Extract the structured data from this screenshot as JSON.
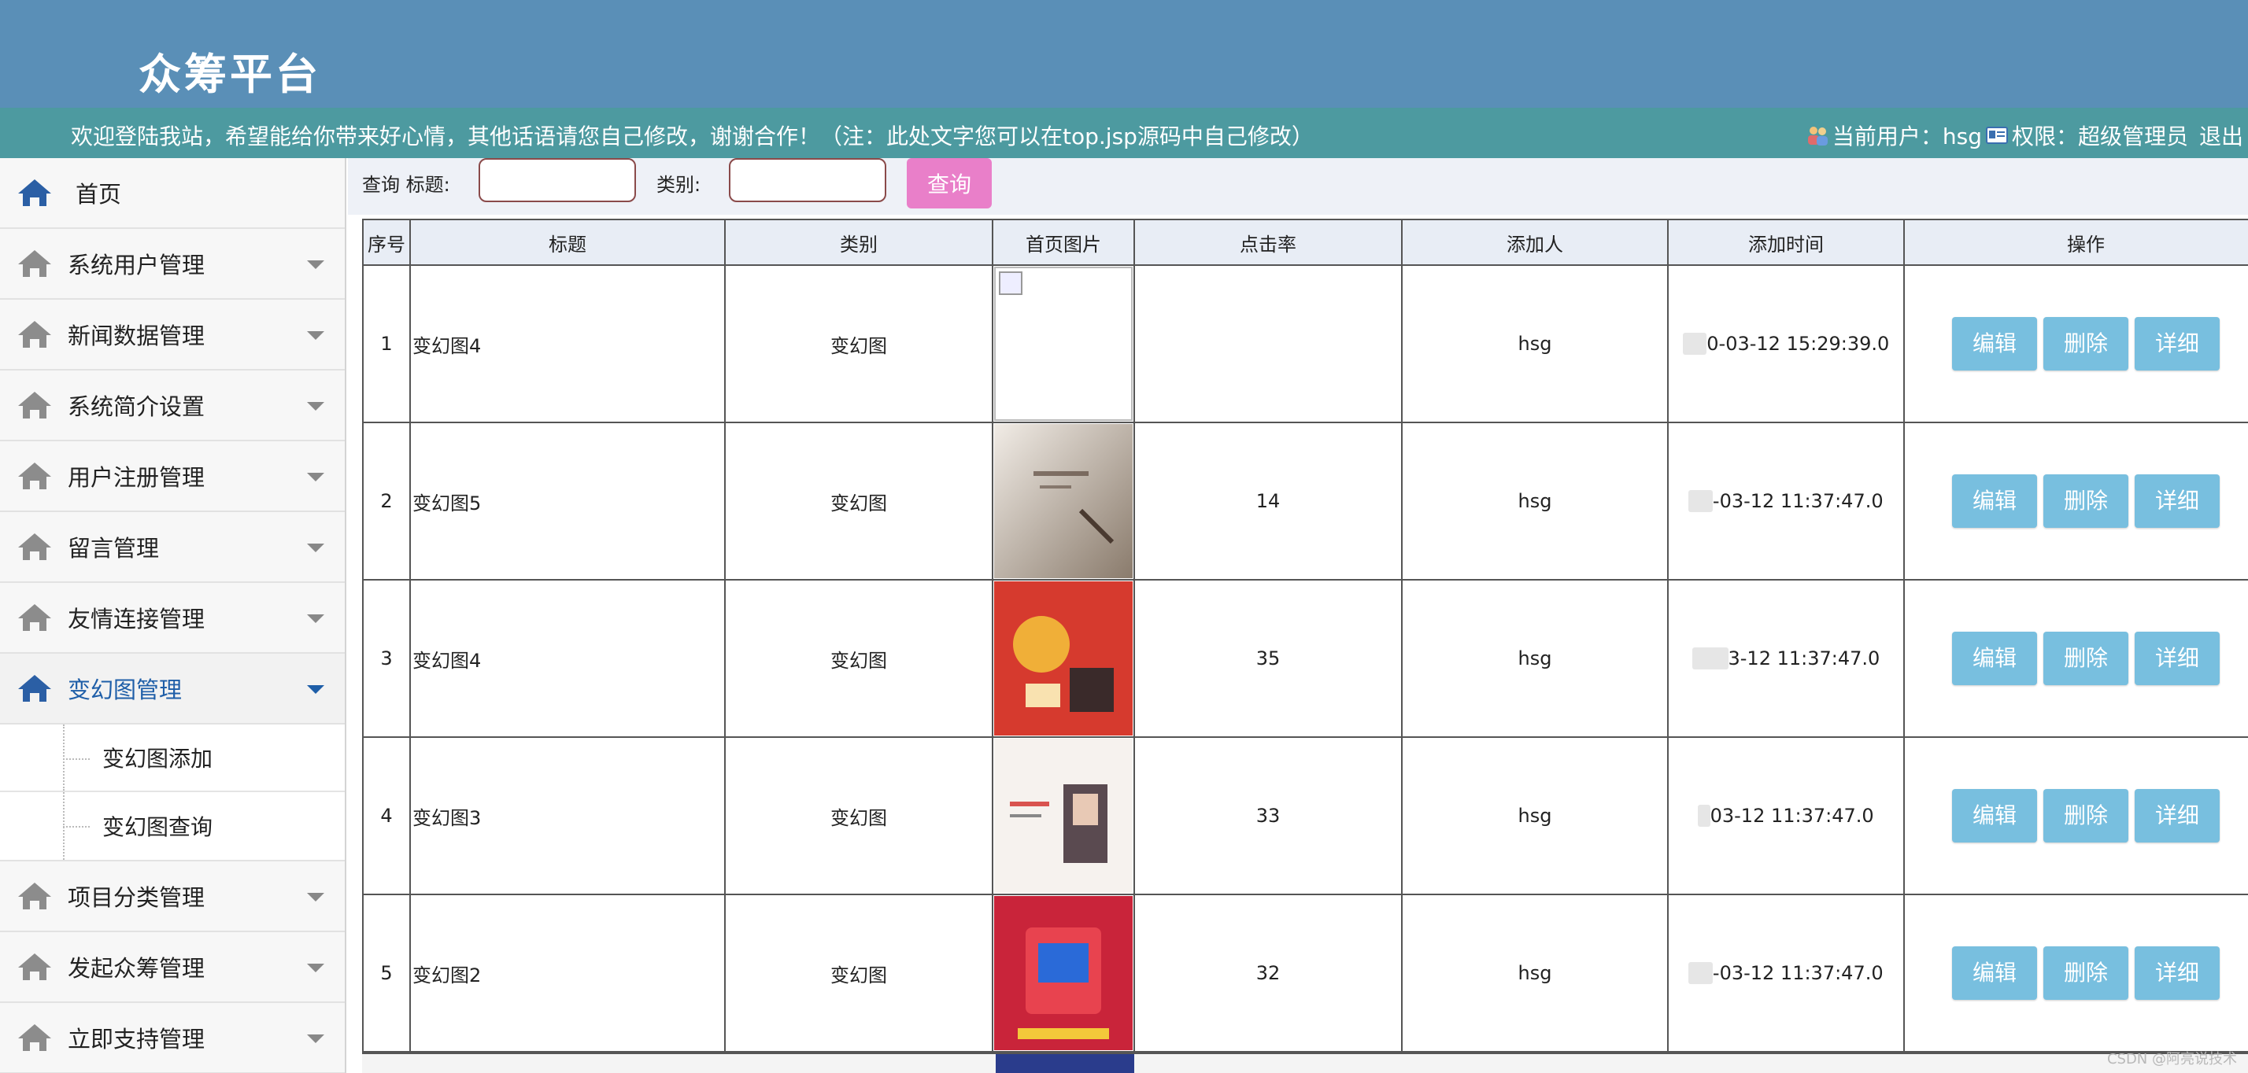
{
  "header": {
    "title": "众筹平台",
    "welcome": "欢迎登陆我站，希望能给你带来好心情，其他话语请您自己修改，谢谢合作！（注：此处文字您可以在top.jsp源码中自己修改）",
    "current_user_label": "当前用户：hsg",
    "role_label": "权限：超级管理员",
    "logout": "退出"
  },
  "sidebar": {
    "home": "首页",
    "items": [
      {
        "label": "系统用户管理"
      },
      {
        "label": "新闻数据管理"
      },
      {
        "label": "系统简介设置"
      },
      {
        "label": "用户注册管理"
      },
      {
        "label": "留言管理"
      },
      {
        "label": "友情连接管理"
      },
      {
        "label": "变幻图管理",
        "active": true,
        "children": [
          "变幻图添加",
          "变幻图查询"
        ]
      },
      {
        "label": "项目分类管理"
      },
      {
        "label": "发起众筹管理"
      },
      {
        "label": "立即支持管理"
      }
    ]
  },
  "search": {
    "query_label": "查询 标题:",
    "title_value": "",
    "category_label": "类别:",
    "category_value": "",
    "button": "查询"
  },
  "table": {
    "headers": [
      "序号",
      "标题",
      "类别",
      "首页图片",
      "点击率",
      "添加人",
      "添加时间",
      "操作"
    ],
    "rows": [
      {
        "no": "1",
        "title": "变幻图4",
        "category": "变幻图",
        "image": "broken",
        "clicks": "",
        "adder": "hsg",
        "time": "0-03-12 15:29:39.0"
      },
      {
        "no": "2",
        "title": "变幻图5",
        "category": "变幻图",
        "image": "sand",
        "clicks": "14",
        "adder": "hsg",
        "time": "-03-12 11:37:47.0"
      },
      {
        "no": "3",
        "title": "变幻图4",
        "category": "变幻图",
        "image": "red",
        "clicks": "35",
        "adder": "hsg",
        "time": "3-12 11:37:47.0"
      },
      {
        "no": "4",
        "title": "变幻图3",
        "category": "变幻图",
        "image": "white",
        "clicks": "33",
        "adder": "hsg",
        "time": "03-12 11:37:47.0"
      },
      {
        "no": "5",
        "title": "变幻图2",
        "category": "变幻图",
        "image": "crimson",
        "clicks": "32",
        "adder": "hsg",
        "time": "-03-12 11:37:47.0"
      }
    ],
    "actions": {
      "edit": "编辑",
      "delete": "删除",
      "detail": "详细"
    }
  },
  "colors": {
    "header": "#5a8fb7",
    "welcome_bar": "#4d9aa0",
    "search_button": "#e97fc9",
    "action_button": "#78bfdf",
    "active_nav": "#1e5ea8"
  },
  "watermark": "CSDN @阿亮说技术"
}
